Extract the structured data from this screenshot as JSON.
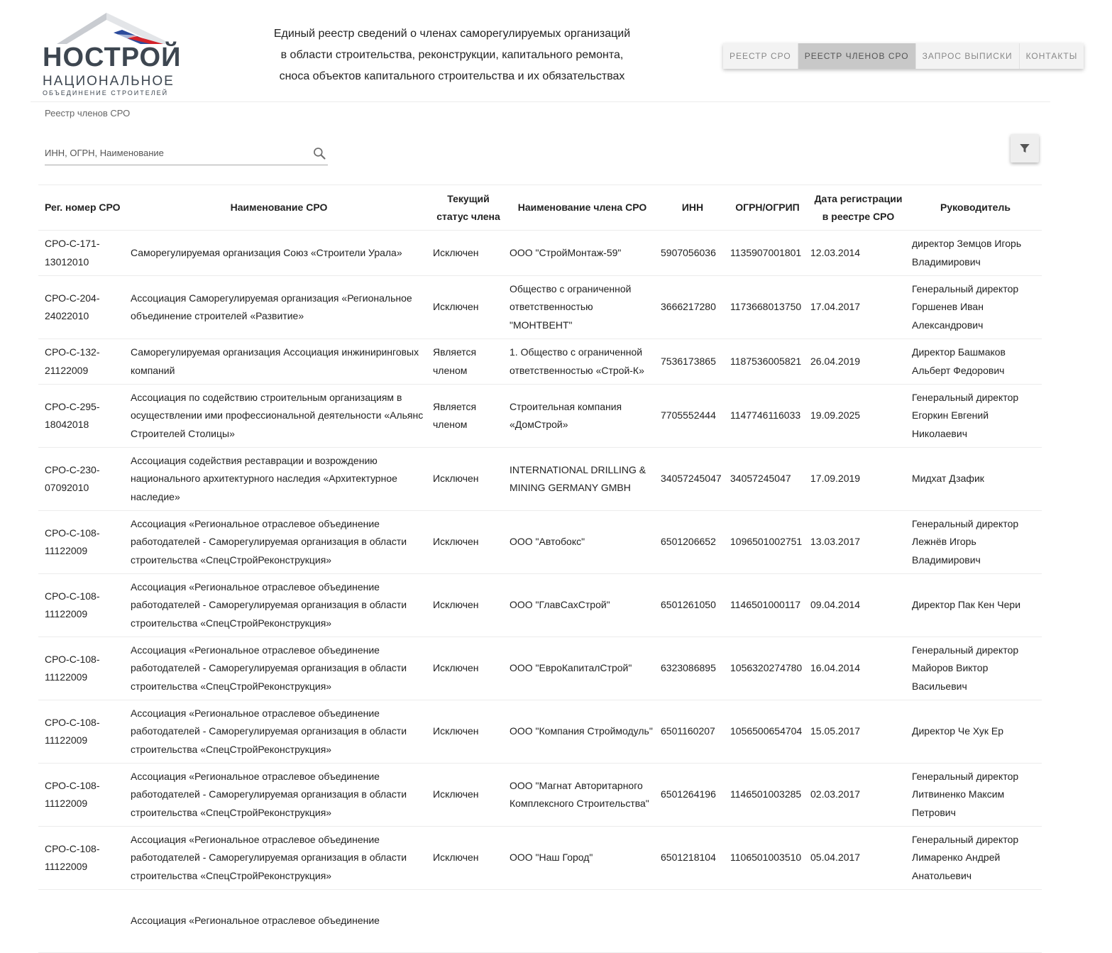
{
  "logo": {
    "brand": "НОСТРОЙ",
    "line1": "НАЦИОНАЛЬНОЕ",
    "line2": "ОБЪЕДИНЕНИЕ СТРОИТЕЛЕЙ"
  },
  "header": {
    "title_lines": [
      "Единый реестр сведений о членах саморегулируемых организаций",
      "в области строительства, реконструкции, капитального ремонта,",
      "сноса объектов капитального строительства и их обязательствах"
    ]
  },
  "nav": {
    "items": [
      "РЕЕСТР СРО",
      "РЕЕСТР ЧЛЕНОВ СРО",
      "ЗАПРОС ВЫПИСКИ",
      "КОНТАКТЫ"
    ],
    "active_index": 1
  },
  "breadcrumb": "Реестр членов СРО",
  "search": {
    "placeholder": "ИНН, ОГРН, Наименование",
    "value": ""
  },
  "icons": {
    "search": "search-icon",
    "filter": "filter-icon"
  },
  "colors": {
    "logo_red": "#d3222a",
    "logo_blue": "#2c4b9c",
    "logo_gray": "#3d4650",
    "nav_active_bg": "#c8c8c8"
  },
  "table": {
    "headers": [
      "Рег. номер СРО",
      "Наименование СРО",
      "Текущий статус члена",
      "Наименование члена СРО",
      "ИНН",
      "ОГРН/ОГРИП",
      "Дата регистрации в реестре СРО",
      "Руководитель"
    ],
    "rows": [
      [
        "СРО-С-171-13012010",
        "Саморегулируемая организация Союз «Строители Урала»",
        "Исключен",
        "ООО \"СтройМонтаж-59\"",
        "5907056036",
        "1135907001801",
        "12.03.2014",
        "директор Земцов Игорь Владимирович"
      ],
      [
        "СРО-С-204-24022010",
        "Ассоциация Саморегулируемая организация «Региональное объединение строителей «Развитие»",
        "Исключен",
        "Общество с ограниченной ответственностью \"МОНТВЕНТ\"",
        "3666217280",
        "1173668013750",
        "17.04.2017",
        "Генеральный директор Горшенев Иван Александрович"
      ],
      [
        "СРО-С-132-21122009",
        "Саморегулируемая организация Ассоциация инжиниринговых компаний",
        "Является членом",
        "1. Общество с ограниченной ответственностью «Строй-К»",
        "7536173865",
        "1187536005821",
        "26.04.2019",
        "Директор Башмаков Альберт Федорович"
      ],
      [
        "СРО-С-295-18042018",
        "Ассоциация по содействию строительным организациям в осуществлении ими профессиональной деятельности «Альянс Строителей Столицы»",
        "Является членом",
        "Строительная компания «ДомСтрой»",
        "7705552444",
        "1147746116033",
        "19.09.2025",
        "Генеральный директор Егоркин Евгений Николаевич"
      ],
      [
        "СРО-С-230-07092010",
        "Ассоциация содействия реставрации и возрождению национального архитектурного наследия «Архитектурное наследие»",
        "Исключен",
        "INTERNATIONAL DRILLING & MINING GERMANY GMBH",
        "34057245047",
        "34057245047",
        "17.09.2019",
        "Мидхат Дзафик"
      ],
      [
        "СРО-С-108-11122009",
        "Ассоциация «Региональное отраслевое объединение работодателей - Саморегулируемая организация в области строительства «СпецСтройРеконструкция»",
        "Исключен",
        "ООО \"Автобокс\"",
        "6501206652",
        "1096501002751",
        "13.03.2017",
        "Генеральный директор Лежнёв Игорь Владимирович"
      ],
      [
        "СРО-С-108-11122009",
        "Ассоциация «Региональное отраслевое объединение работодателей - Саморегулируемая организация в области строительства «СпецСтройРеконструкция»",
        "Исключен",
        "ООО \"ГлавСахСтрой\"",
        "6501261050",
        "1146501000117",
        "09.04.2014",
        "Директор Пак Кен Чери"
      ],
      [
        "СРО-С-108-11122009",
        "Ассоциация «Региональное отраслевое объединение работодателей - Саморегулируемая организация в области строительства «СпецСтройРеконструкция»",
        "Исключен",
        "ООО \"ЕвроКапиталСтрой\"",
        "6323086895",
        "1056320274780",
        "16.04.2014",
        "Генеральный директор Майоров Виктор Васильевич"
      ],
      [
        "СРО-С-108-11122009",
        "Ассоциация «Региональное отраслевое объединение работодателей - Саморегулируемая организация в области строительства «СпецСтройРеконструкция»",
        "Исключен",
        "ООО \"Компания Строймодуль\"",
        "6501160207",
        "1056500654704",
        "15.05.2017",
        "Директор Че Хук Ер"
      ],
      [
        "СРО-С-108-11122009",
        "Ассоциация «Региональное отраслевое объединение работодателей - Саморегулируемая организация в области строительства «СпецСтройРеконструкция»",
        "Исключен",
        "ООО \"Магнат Авторитарного Комплексного Строительства\"",
        "6501264196",
        "1146501003285",
        "02.03.2017",
        "Генеральный директор Литвиненко Максим Петрович"
      ],
      [
        "СРО-С-108-11122009",
        "Ассоциация «Региональное отраслевое объединение работодателей - Саморегулируемая организация в области строительства «СпецСтройРеконструкция»",
        "Исключен",
        "ООО \"Наш Город\"",
        "6501218104",
        "1106501003510",
        "05.04.2017",
        "Генеральный директор Лимаренко Андрей Анатольевич"
      ],
      [
        "",
        "Ассоциация «Региональное отраслевое объединение",
        "",
        "",
        "",
        "",
        "",
        ""
      ]
    ]
  }
}
